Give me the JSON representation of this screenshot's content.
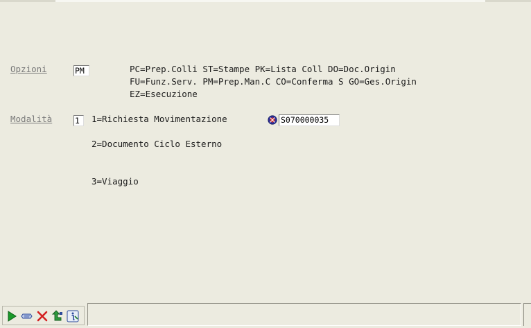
{
  "form": {
    "opzioni": {
      "label": "Opzioni",
      "value": "PM",
      "legend_lines": [
        "PC=Prep.Colli ST=Stampe PK=Lista Coll DO=Doc.Origin",
        "FU=Funz.Serv. PM=Prep.Man.C CO=Conferma S GO=Ges.Origin",
        "EZ=Esecuzione"
      ]
    },
    "modalita": {
      "label": "Modalità",
      "value": "1",
      "options": [
        "1=Richiesta Movimentazione",
        "2=Documento Ciclo Esterno",
        "3=Viaggio"
      ],
      "code_value": "S070000035"
    }
  },
  "toolbar": {
    "buttons": [
      {
        "name": "run",
        "icon": "play-icon"
      },
      {
        "name": "clear",
        "icon": "eraser-icon"
      },
      {
        "name": "cancel",
        "icon": "close-icon"
      },
      {
        "name": "back",
        "icon": "return-arrow-icon"
      },
      {
        "name": "info",
        "icon": "info-icon"
      }
    ]
  },
  "colors": {
    "background": "#ecebe0",
    "label": "#7a7a7a",
    "play": "#1a9a2a",
    "cancel": "#d42020"
  }
}
